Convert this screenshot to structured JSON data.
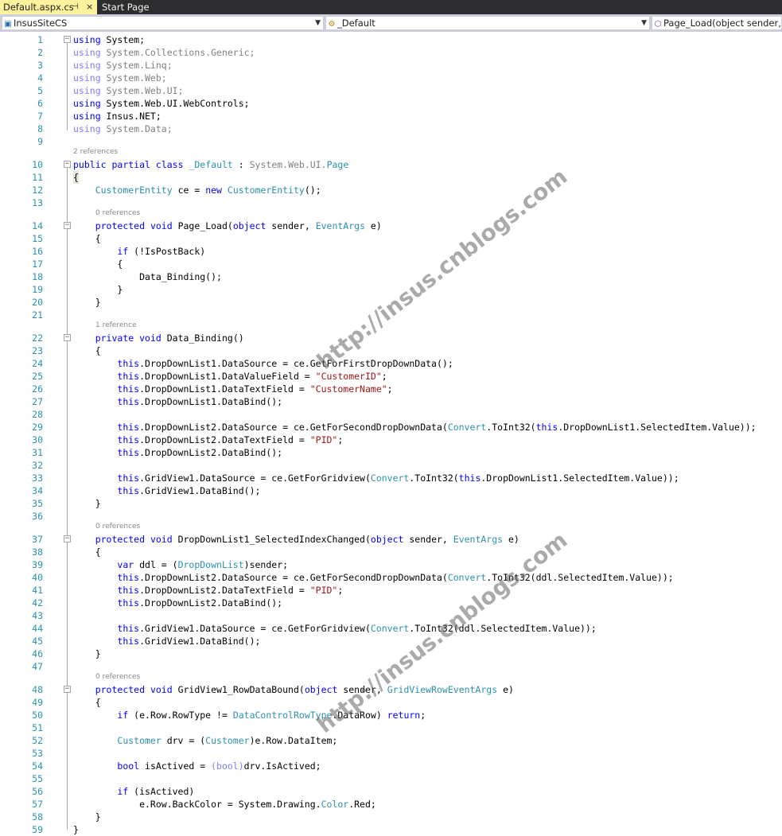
{
  "tabs": [
    {
      "label": "Default.aspx.cs",
      "pin": "⊣",
      "close": "×"
    },
    {
      "label": "Start Page"
    }
  ],
  "nav": {
    "project": "InsusSiteCS",
    "class": "_Default",
    "member": "Page_Load(object sender, E"
  },
  "watermark": "http://insus.cnblogs.com",
  "code_lens": {
    "l10": "2 references",
    "l14": "0 references",
    "l22": "1 reference",
    "l37": "0 references",
    "l48": "0 references"
  },
  "code": {
    "l1": "using System;",
    "l2": "using System.Collections.Generic;",
    "l3": "using System.Linq;",
    "l4": "using System.Web;",
    "l5": "using System.Web.UI;",
    "l6": "using System.Web.UI.WebControls;",
    "l7": "using Insus.NET;",
    "l8": "using System.Data;",
    "l10": "public partial class _Default : System.Web.UI.Page",
    "l11": "{",
    "l12": "    CustomerEntity ce = new CustomerEntity();",
    "l14": "    protected void Page_Load(object sender, EventArgs e)",
    "l15": "    {",
    "l16": "        if (!IsPostBack)",
    "l17": "        {",
    "l18": "            Data_Binding();",
    "l19": "        }",
    "l20": "    }",
    "l22": "    private void Data_Binding()",
    "l23": "    {",
    "l24": "        this.DropDownList1.DataSource = ce.GetForFirstDropDownData();",
    "l25": "        this.DropDownList1.DataValueField = \"CustomerID\";",
    "l26": "        this.DropDownList1.DataTextField = \"CustomerName\";",
    "l27": "        this.DropDownList1.DataBind();",
    "l29": "        this.DropDownList2.DataSource = ce.GetForSecondDropDownData(Convert.ToInt32(this.DropDownList1.SelectedItem.Value));",
    "l30": "        this.DropDownList2.DataTextField = \"PID\";",
    "l31": "        this.DropDownList2.DataBind();",
    "l33": "        this.GridView1.DataSource = ce.GetForGridview(Convert.ToInt32(this.DropDownList1.SelectedItem.Value));",
    "l34": "        this.GridView1.DataBind();",
    "l35": "    }",
    "l37": "    protected void DropDownList1_SelectedIndexChanged(object sender, EventArgs e)",
    "l38": "    {",
    "l39": "        var ddl = (DropDownList)sender;",
    "l40": "        this.DropDownList2.DataSource = ce.GetForSecondDropDownData(Convert.ToInt32(ddl.SelectedItem.Value));",
    "l41": "        this.DropDownList2.DataTextField = \"PID\";",
    "l42": "        this.DropDownList2.DataBind();",
    "l44": "        this.GridView1.DataSource = ce.GetForGridview(Convert.ToInt32(ddl.SelectedItem.Value));",
    "l45": "        this.GridView1.DataBind();",
    "l46": "    }",
    "l48": "    protected void GridView1_RowDataBound(object sender, GridViewRowEventArgs e)",
    "l49": "    {",
    "l50": "        if (e.Row.RowType != DataControlRowType.DataRow) return;",
    "l52": "        Customer drv = (Customer)e.Row.DataItem;",
    "l54": "        bool isActived = (bool)drv.IsActived;",
    "l56": "        if (isActived)",
    "l57": "            e.Row.BackColor = System.Drawing.Color.Red;",
    "l58": "    }",
    "l59": "}"
  }
}
